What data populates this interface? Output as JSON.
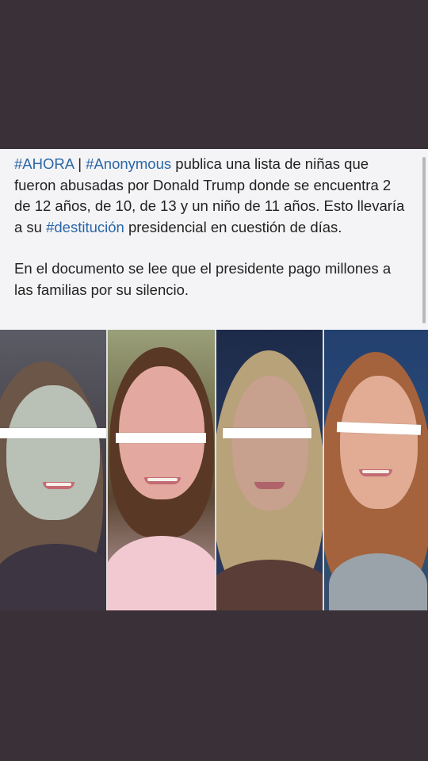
{
  "post": {
    "paragraph1": [
      {
        "text": "#AHORA",
        "type": "hashtag"
      },
      {
        "text": " | ",
        "type": "text"
      },
      {
        "text": "#Anonymous",
        "type": "hashtag"
      },
      {
        "text": " publica una lista de niñas que fueron abusadas por Donald Trump donde se encuentra 2 de 12 años, de 10, de 13 y un niño de 11 años. Esto llevaría a su ",
        "type": "text"
      },
      {
        "text": "#destitución",
        "type": "hashtag"
      },
      {
        "text": " presidencial en cuestión de días.",
        "type": "text"
      }
    ],
    "paragraph2": "En el documento se lee que el presidente pago millones a las familias por su silencio."
  },
  "photos": [
    {
      "name": "portrait-1"
    },
    {
      "name": "portrait-2"
    },
    {
      "name": "portrait-3"
    },
    {
      "name": "portrait-4"
    }
  ],
  "colors": {
    "background": "#3a3138",
    "card": "#f4f4f6",
    "hashtag": "#2b66a6",
    "text": "#222222"
  }
}
